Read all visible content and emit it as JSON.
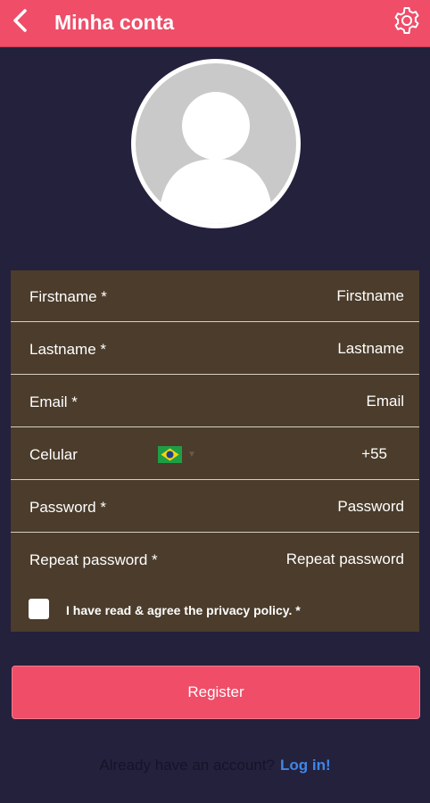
{
  "header": {
    "title": "Minha conta",
    "back_icon": "chevron-left-icon",
    "settings_icon": "gear-icon"
  },
  "colors": {
    "accent": "#ef4d68",
    "background": "#24213d",
    "form_background": "#4b3c2b",
    "link": "#3f86e6"
  },
  "form": {
    "firstname": {
      "label": "Firstname *",
      "placeholder": "Firstname"
    },
    "lastname": {
      "label": "Lastname *",
      "placeholder": "Lastname"
    },
    "email": {
      "label": "Email *",
      "placeholder": "Email"
    },
    "phone": {
      "label": "Celular",
      "country_flag": "brazil-flag-icon",
      "value": "+55"
    },
    "password": {
      "label": "Password *",
      "placeholder": "Password"
    },
    "repeat_password": {
      "label": "Repeat password *",
      "placeholder": "Repeat password"
    },
    "policy_label": "I have read & agree the privacy policy. *"
  },
  "register_label": "Register",
  "login": {
    "prompt": "Already have an account?",
    "link": "Log in!"
  }
}
